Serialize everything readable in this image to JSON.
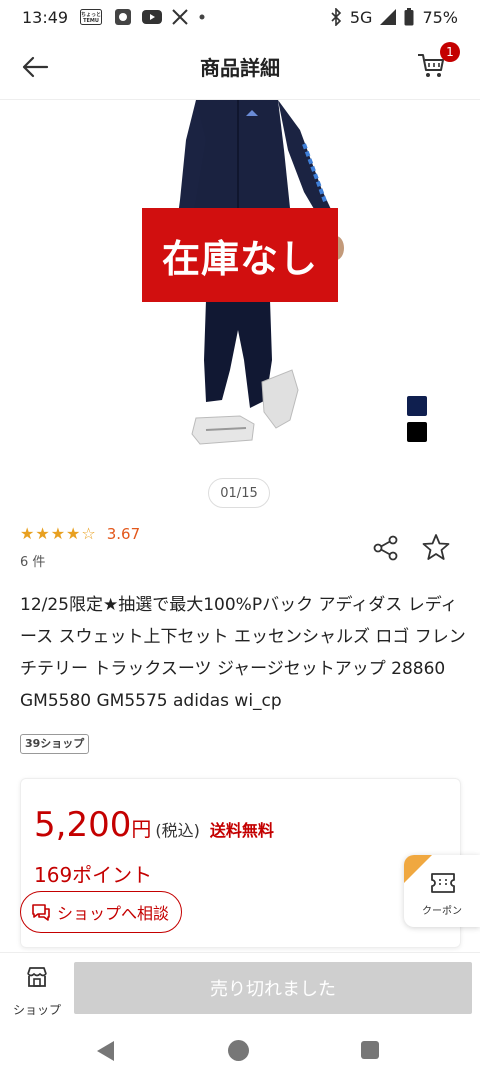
{
  "status_bar": {
    "time": "13:49",
    "temu_label": "ちょっと\nTEMU",
    "network": "5G",
    "battery": "75%"
  },
  "header": {
    "title": "商品詳細",
    "cart_count": "1"
  },
  "product_image": {
    "overlay_text": "在庫なし",
    "color_swatches": [
      "#0f1f4f",
      "#000000"
    ],
    "page_indicator": "01/15"
  },
  "rating": {
    "stars": "★★★★☆",
    "value": "3.67",
    "review_count": "6 件"
  },
  "product": {
    "title": "12/25限定★抽選で最大100%Pバック アディダス レディース スウェット上下セット エッセンシャルズ ロゴ フレンチテリー トラックスーツ ジャージセットアップ 28860 GM5580 GM5575 adidas wi_cp",
    "shop_badge": "39ショップ"
  },
  "price": {
    "amount": "5,200",
    "yen": "円",
    "tax_label": "(税込)",
    "shipping": "送料無料",
    "points": "169ポイント",
    "consult_label": "ショップへ相談"
  },
  "coupon": {
    "label": "クーポン"
  },
  "bottom_bar": {
    "shop_label": "ショップ",
    "soldout_label": "売り切れました"
  },
  "colors": {
    "accent": "#c40000",
    "overlay_red": "#d10f0f",
    "star": "#e8a020"
  }
}
